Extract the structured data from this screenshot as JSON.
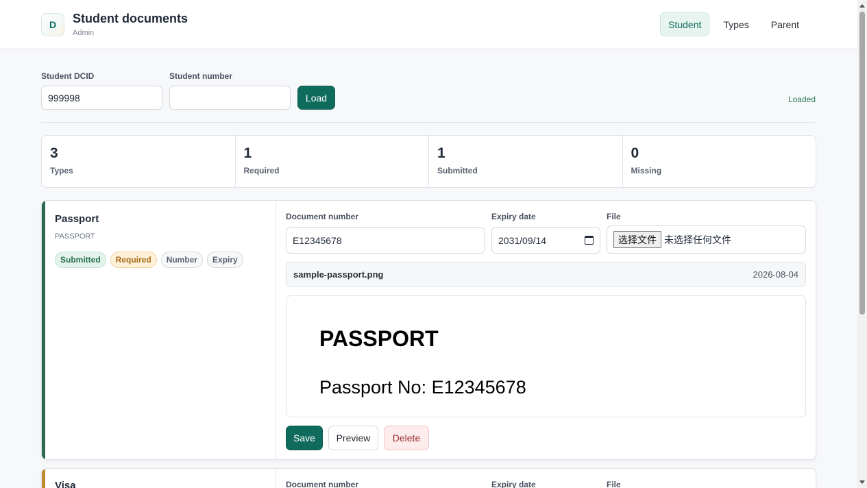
{
  "header": {
    "logo_letter": "D",
    "title": "Student documents",
    "subtitle": "Admin",
    "tabs": [
      {
        "label": "Student",
        "active": true
      },
      {
        "label": "Types",
        "active": false
      },
      {
        "label": "Parent",
        "active": false
      }
    ]
  },
  "lookup": {
    "dcid_label": "Student DCID",
    "dcid_value": "999998",
    "number_label": "Student number",
    "number_value": "",
    "load_label": "Load",
    "status": "Loaded"
  },
  "stats": [
    {
      "value": "3",
      "label": "Types"
    },
    {
      "value": "1",
      "label": "Required"
    },
    {
      "value": "1",
      "label": "Submitted"
    },
    {
      "value": "0",
      "label": "Missing"
    }
  ],
  "documents": [
    {
      "name": "Passport",
      "code": "PASSPORT",
      "accent_color": "#2d6a4f",
      "badges": [
        {
          "label": "Submitted",
          "kind": "submitted"
        },
        {
          "label": "Required",
          "kind": "required"
        },
        {
          "label": "Number",
          "kind": "neutral"
        },
        {
          "label": "Expiry",
          "kind": "neutral"
        }
      ],
      "number_label": "Document number",
      "number_value": "E12345678",
      "expiry_label": "Expiry date",
      "expiry_value": "2031/09/14",
      "file_label": "File",
      "file_button": "选择文件",
      "file_status": "未选择任何文件",
      "uploaded_file": "sample-passport.png",
      "uploaded_date": "2026-08-04",
      "preview_heading": "PASSPORT",
      "preview_text": "Passport No: E12345678",
      "actions": {
        "save": "Save",
        "preview": "Preview",
        "delete": "Delete"
      }
    },
    {
      "name": "Visa",
      "accent_color": "#c08a2e",
      "number_label": "Document number",
      "expiry_label": "Expiry date",
      "file_label": "File"
    }
  ]
}
